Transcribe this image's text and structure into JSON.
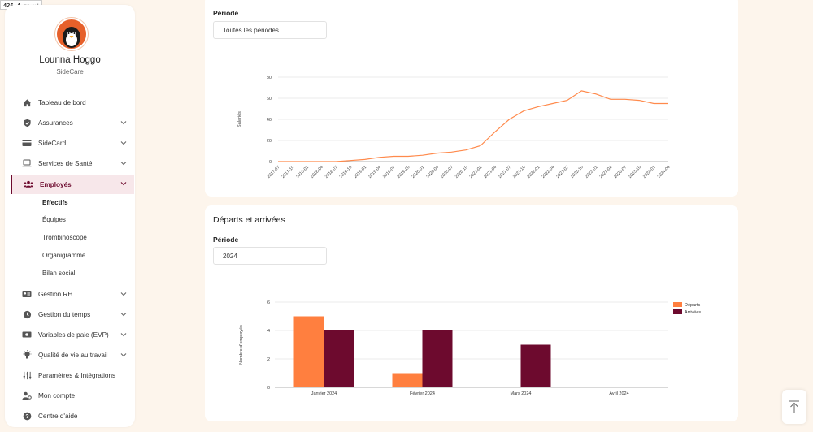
{
  "perf": {
    "value": "426.4",
    "unit": "ms",
    "suffix": "×4"
  },
  "user": {
    "name": "Lounna Hoggo",
    "company": "SideCare"
  },
  "nav": [
    {
      "label": "Tableau de bord",
      "icon": "home-icon",
      "chevron": false
    },
    {
      "label": "Assurances",
      "icon": "shield-icon",
      "chevron": true
    },
    {
      "label": "SideCard",
      "icon": "credit-card-icon",
      "chevron": true
    },
    {
      "label": "Services de Santé",
      "icon": "laptop-icon",
      "chevron": true
    },
    {
      "label": "Employés",
      "icon": "users-icon",
      "chevron": true,
      "active": true
    },
    {
      "label": "Gestion RH",
      "icon": "id-card-icon",
      "chevron": true
    },
    {
      "label": "Gestion du temps",
      "icon": "clock-icon",
      "chevron": true
    },
    {
      "label": "Variables de paie (EVP)",
      "icon": "money-icon",
      "chevron": true
    },
    {
      "label": "Qualité de vie au travail",
      "icon": "lightbulb-icon",
      "chevron": true
    },
    {
      "label": "Paramètres & Intégrations",
      "icon": "sliders-icon",
      "chevron": false
    },
    {
      "label": "Mon compte",
      "icon": "user-gear-icon",
      "chevron": false
    },
    {
      "label": "Centre d'aide",
      "icon": "help-icon",
      "chevron": false
    }
  ],
  "subnav": [
    {
      "label": "Effectifs",
      "active": true
    },
    {
      "label": "Équipes"
    },
    {
      "label": "Trombinoscope"
    },
    {
      "label": "Organigramme"
    },
    {
      "label": "Bilan social"
    }
  ],
  "card1": {
    "period_label": "Période",
    "period_value": "Toutes les périodes"
  },
  "card2": {
    "title": "Départs et arrivées",
    "period_label": "Période",
    "period_value": "2024"
  },
  "colors": {
    "accent": "#6d0a2e",
    "orange": "#ff7f3f",
    "line": "#ff8a4c"
  },
  "chart_data": [
    {
      "type": "line",
      "ylabel": "Salariés",
      "ylim": [
        0,
        80
      ],
      "yticks": [
        0,
        20,
        40,
        60,
        80
      ],
      "x": [
        "2017-07",
        "2017-10",
        "2018-01",
        "2018-04",
        "2018-07",
        "2018-10",
        "2019-01",
        "2019-04",
        "2019-07",
        "2019-10",
        "2020-01",
        "2020-04",
        "2020-07",
        "2020-10",
        "2021-01",
        "2021-04",
        "2021-07",
        "2021-10",
        "2022-01",
        "2022-04",
        "2022-07",
        "2022-10",
        "2023-01",
        "2023-04",
        "2023-07",
        "2023-10",
        "2024-01",
        "2024-04"
      ],
      "series": [
        {
          "values": [
            0,
            0,
            0,
            0,
            0,
            1,
            2,
            4,
            5,
            5,
            6,
            8,
            9,
            11,
            15,
            28,
            40,
            48,
            52,
            55,
            58,
            67,
            64,
            59,
            59,
            58,
            55,
            55
          ]
        }
      ]
    },
    {
      "type": "bar",
      "ylabel": "Nombre d'employés",
      "ylim": [
        0,
        6
      ],
      "yticks": [
        0,
        2,
        4,
        6
      ],
      "categories": [
        "Janvier 2024",
        "Février 2024",
        "Mars 2024",
        "Avril 2024"
      ],
      "legend_position": "top-right",
      "series": [
        {
          "name": "Départs",
          "color": "#ff7f3f",
          "values": [
            5,
            1,
            0,
            0
          ]
        },
        {
          "name": "Arrivées",
          "color": "#6d0a2e",
          "values": [
            4,
            4,
            3,
            0
          ]
        }
      ]
    }
  ]
}
